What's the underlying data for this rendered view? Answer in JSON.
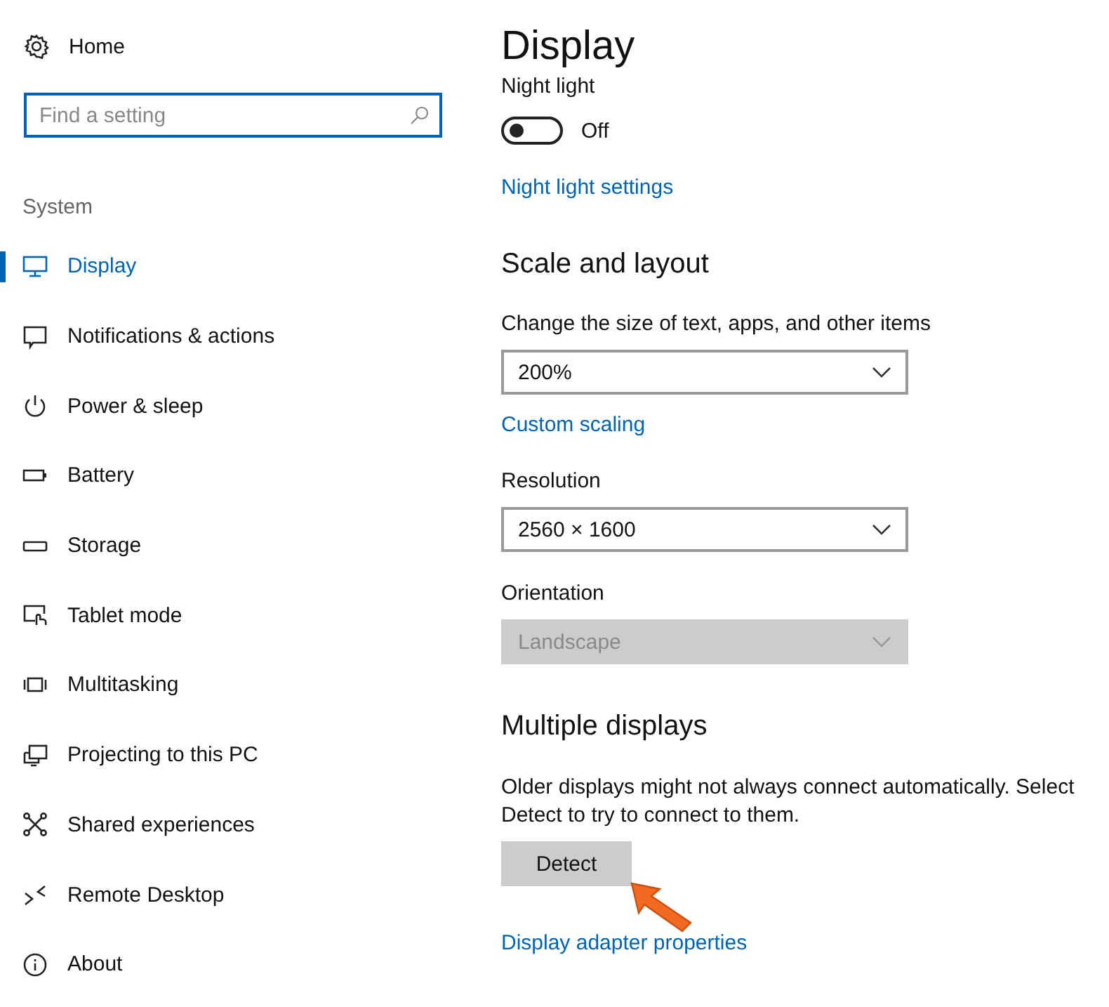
{
  "sidebar": {
    "home": {
      "label": "Home"
    },
    "search": {
      "placeholder": "Find a setting"
    },
    "section": "System",
    "items": [
      {
        "label": "Display",
        "selected": true
      },
      {
        "label": "Notifications & actions",
        "selected": false
      },
      {
        "label": "Power & sleep",
        "selected": false
      },
      {
        "label": "Battery",
        "selected": false
      },
      {
        "label": "Storage",
        "selected": false
      },
      {
        "label": "Tablet mode",
        "selected": false
      },
      {
        "label": "Multitasking",
        "selected": false
      },
      {
        "label": "Projecting to this PC",
        "selected": false
      },
      {
        "label": "Shared experiences",
        "selected": false
      },
      {
        "label": "Remote Desktop",
        "selected": false
      },
      {
        "label": "About",
        "selected": false
      }
    ]
  },
  "main": [
    {
      "kind": "title",
      "text": "Display"
    },
    {
      "kind": "label",
      "text": "Night light"
    },
    {
      "kind": "toggle",
      "on": false,
      "text": "Off"
    },
    {
      "kind": "link",
      "text": "Night light settings"
    },
    {
      "kind": "heading",
      "text": "Scale and layout"
    },
    {
      "kind": "label",
      "text": "Change the size of text, apps, and other items"
    },
    {
      "kind": "dropdown",
      "value": "200%",
      "disabled": false
    },
    {
      "kind": "link",
      "text": "Custom scaling"
    },
    {
      "kind": "label",
      "text": "Resolution"
    },
    {
      "kind": "dropdown",
      "value": "2560 × 1600",
      "disabled": false
    },
    {
      "kind": "label",
      "text": "Orientation"
    },
    {
      "kind": "dropdown",
      "value": "Landscape",
      "disabled": true
    },
    {
      "kind": "heading",
      "text": "Multiple displays"
    },
    {
      "kind": "paragraph",
      "text": "Older displays might not always connect automatically. Select Detect to try to connect to them."
    },
    {
      "kind": "button",
      "text": "Detect"
    },
    {
      "kind": "link",
      "text": "Display adapter properties"
    }
  ],
  "annotation": {
    "kind": "arrow"
  }
}
